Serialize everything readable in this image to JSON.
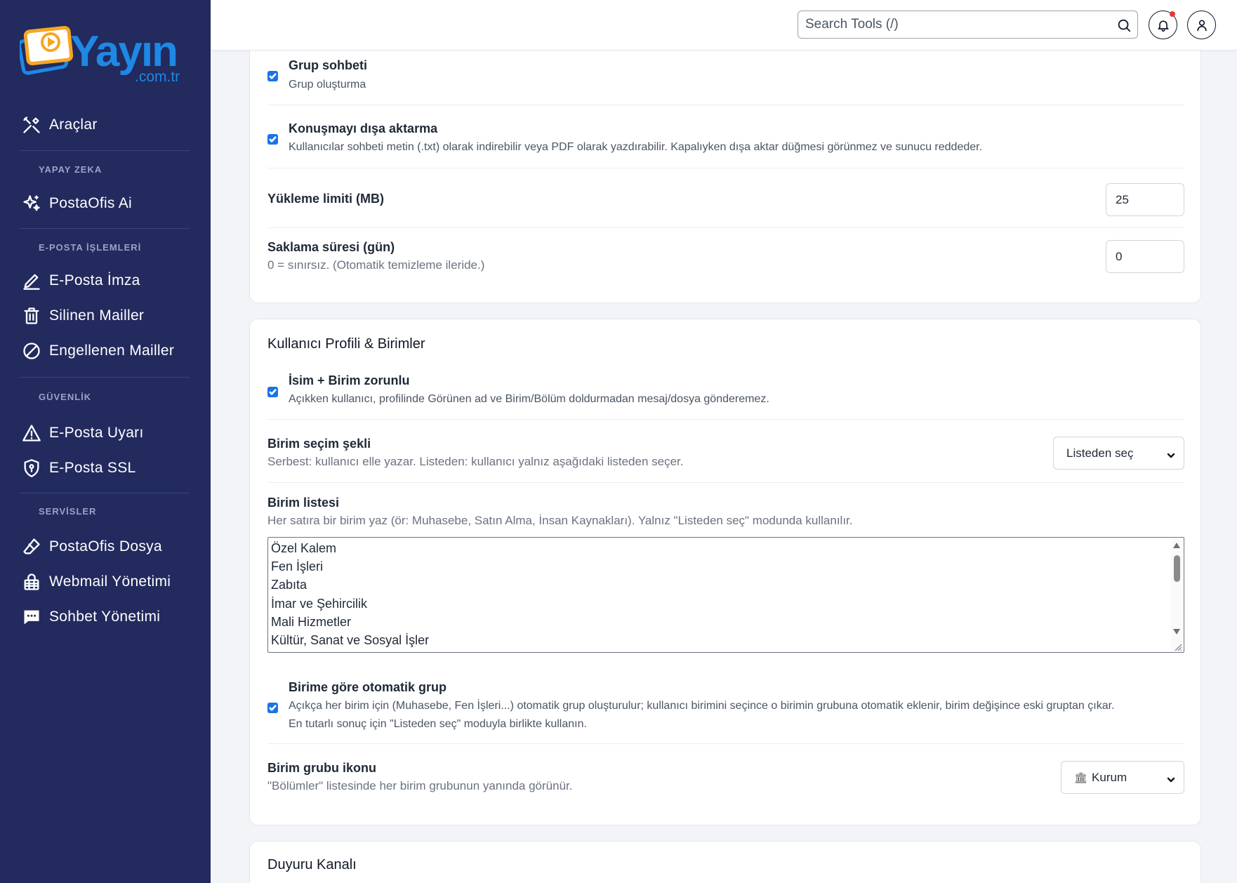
{
  "brand": {
    "name": "Yayın",
    "domain": ".com.tr",
    "colors": {
      "primary": "#1e88e5",
      "accent": "#f5a623"
    }
  },
  "sidebar": {
    "items": [
      {
        "label": "Araçlar",
        "icon": "tools-icon"
      },
      {
        "section": "YAPAY ZEKA"
      },
      {
        "label": "PostaOfis Ai",
        "icon": "sparkles-icon"
      },
      {
        "section": "E-POSTA İŞLEMLERİ"
      },
      {
        "label": "E-Posta İmza",
        "icon": "pen-icon"
      },
      {
        "label": "Silinen Mailler",
        "icon": "trash-icon"
      },
      {
        "label": "Engellenen Mailler",
        "icon": "block-icon"
      },
      {
        "section": "GÜVENLİK"
      },
      {
        "label": "E-Posta Uyarı",
        "icon": "warning-icon"
      },
      {
        "label": "E-Posta SSL",
        "icon": "shield-icon"
      },
      {
        "section": "SERVİSLER"
      },
      {
        "label": "PostaOfis Dosya",
        "icon": "eraser-icon"
      },
      {
        "label": "Webmail Yönetimi",
        "icon": "lock-icon"
      },
      {
        "label": "Sohbet Yönetimi",
        "icon": "chat-icon"
      }
    ]
  },
  "topbar": {
    "search_placeholder": "Search Tools (/)",
    "notification_dot_color": "#e53935"
  },
  "chat_settings": {
    "group_chat": {
      "title": "Grup sohbeti",
      "desc": "Grup oluşturma",
      "checked": true
    },
    "export": {
      "title": "Konuşmayı dışa aktarma",
      "desc": "Kullanıcılar sohbeti metin (.txt) olarak indirebilir veya PDF olarak yazdırabilir. Kapalıyken dışa aktar düğmesi görünmez ve sunucu reddeder.",
      "checked": true
    },
    "upload_limit": {
      "title": "Yükleme limiti (MB)",
      "value": "25"
    },
    "retention": {
      "title": "Saklama süresi (gün)",
      "desc": "0 = sınırsız. (Otomatik temizleme ileride.)",
      "value": "0"
    }
  },
  "profile_section": {
    "title": "Kullanıcı Profili & Birimler",
    "name_required": {
      "title": "İsim + Birim zorunlu",
      "desc": "Açıkken kullanıcı, profilinde Görünen ad ve Birim/Bölüm doldurmadan mesaj/dosya gönderemez.",
      "checked": true
    },
    "unit_selection": {
      "title": "Birim seçim şekli",
      "desc": "Serbest: kullanıcı elle yazar. Listeden: kullanıcı yalnız aşağıdaki listeden seçer.",
      "selected": "Listeden seç"
    },
    "unit_list": {
      "title": "Birim listesi",
      "desc": "Her satıra bir birim yaz (ör: Muhasebe, Satın Alma, İnsan Kaynakları). Yalnız \"Listeden seç\" modunda kullanılır.",
      "lines": [
        "Özel Kalem",
        "Fen İşleri",
        "Zabıta",
        "İmar ve Şehircilik",
        "Mali Hizmetler",
        "Kültür, Sanat ve Sosyal İşler"
      ]
    },
    "auto_group": {
      "title": "Birime göre otomatik grup",
      "desc1": "Açıkça her birim için (Muhasebe, Fen İşleri...) otomatik grup oluşturulur; kullanıcı birimini seçince o birimin grubuna otomatik eklenir, birim değişince eski gruptan çıkar.",
      "desc2": "En tutarlı sonuç için \"Listeden seç\" moduyla birlikte kullanın.",
      "checked": true
    },
    "group_icon": {
      "title": "Birim grubu ikonu",
      "desc": "\"Bölümler\" listesinde her birim grubunun yanında görünür.",
      "selected_icon": "🏛",
      "selected": "Kurum"
    }
  },
  "announcement_section": {
    "title": "Duyuru Kanalı"
  }
}
